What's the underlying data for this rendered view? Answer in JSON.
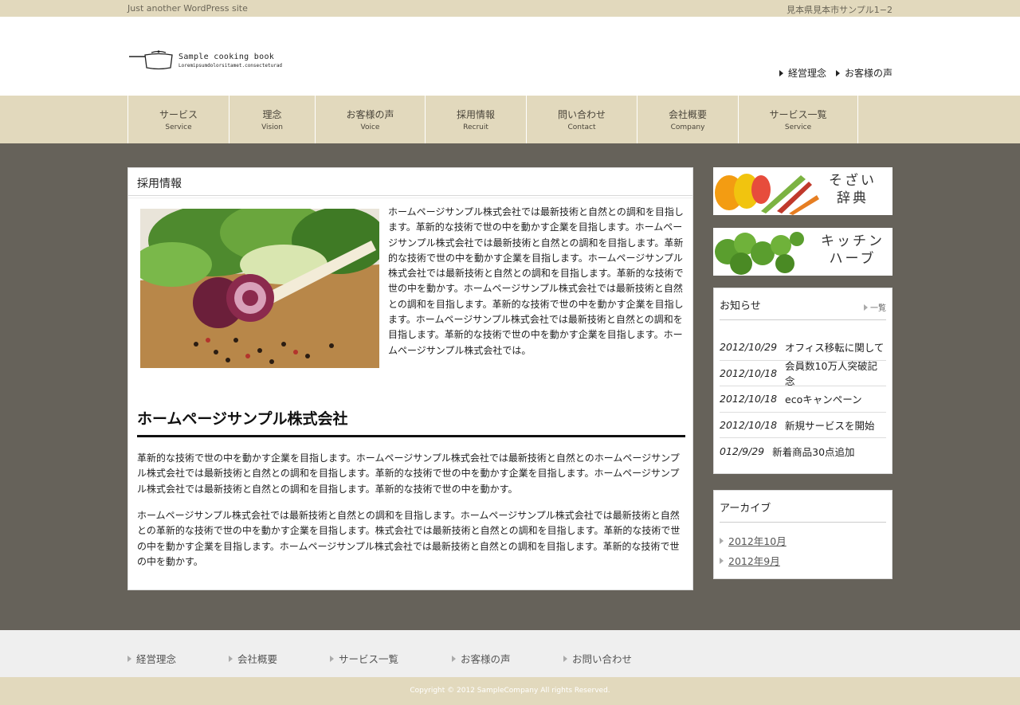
{
  "topbar": {
    "tagline": "Just another WordPress site",
    "address": "見本県見本市サンプル1−2"
  },
  "logo": {
    "title": "Sample cooking book",
    "subtitle": "Loremipsumdolorsitamet.consecteturad"
  },
  "header_links": [
    "経営理念",
    "お客様の声"
  ],
  "nav": [
    {
      "ja": "サービス",
      "en": "Service"
    },
    {
      "ja": "理念",
      "en": "Vision"
    },
    {
      "ja": "お客様の声",
      "en": "Voice"
    },
    {
      "ja": "採用情報",
      "en": "Recruit"
    },
    {
      "ja": "問い合わせ",
      "en": "Contact"
    },
    {
      "ja": "会社概要",
      "en": "Company"
    },
    {
      "ja": "サービス一覧",
      "en": "Service"
    }
  ],
  "main": {
    "page_title": "採用情報",
    "intro": "ホームページサンプル株式会社では最新技術と自然との調和を目指します。革新的な技術で世の中を動かす企業を目指します。ホームページサンプル株式会社では最新技術と自然との調和を目指します。革新的な技術で世の中を動かす企業を目指します。ホームページサンプル株式会社では最新技術と自然との調和を目指します。革新的な技術で世の中を動かす。ホームページサンプル株式会社では最新技術と自然との調和を目指します。革新的な技術で世の中を動かす企業を目指します。ホームページサンプル株式会社では最新技術と自然との調和を目指します。革新的な技術で世の中を動かす企業を目指します。ホームページサンプル株式会社では。",
    "heading": "ホームページサンプル株式会社",
    "para1": "革新的な技術で世の中を動かす企業を目指します。ホームページサンプル株式会社では最新技術と自然とのホームページサンプル株式会社では最新技術と自然との調和を目指します。革新的な技術で世の中を動かす企業を目指します。ホームページサンプル株式会社では最新技術と自然との調和を目指します。革新的な技術で世の中を動かす。",
    "para2": "ホームページサンプル株式会社では最新技術と自然との調和を目指します。ホームページサンプル株式会社では最新技術と自然との革新的な技術で世の中を動かす企業を目指します。株式会社では最新技術と自然との調和を目指します。革新的な技術で世の中を動かす企業を目指します。ホームページサンプル株式会社では最新技術と自然との調和を目指します。革新的な技術で世の中を動かす。"
  },
  "sidebar": {
    "banner1": "そざい\n辞典",
    "banner2": "キッチン\nハーブ",
    "news_title": "お知らせ",
    "news_more": "一覧",
    "news": [
      {
        "date": "2012/10/29",
        "title": "オフィス移転に関して"
      },
      {
        "date": "2012/10/18",
        "title": "会員数10万人突破記念"
      },
      {
        "date": "2012/10/18",
        "title": "ecoキャンペーン"
      },
      {
        "date": "2012/10/18",
        "title": "新規サービスを開始"
      },
      {
        "date": "012/9/29",
        "title": "新着商品30点追加"
      }
    ],
    "archive_title": "アーカイブ",
    "archive": [
      "2012年10月",
      "2012年9月"
    ]
  },
  "footer_nav": [
    "経営理念",
    "会社概要",
    "サービス一覧",
    "お客様の声",
    "お問い合わせ"
  ],
  "copyright": "Copyright © 2012 SampleCompany All rights Reserved."
}
